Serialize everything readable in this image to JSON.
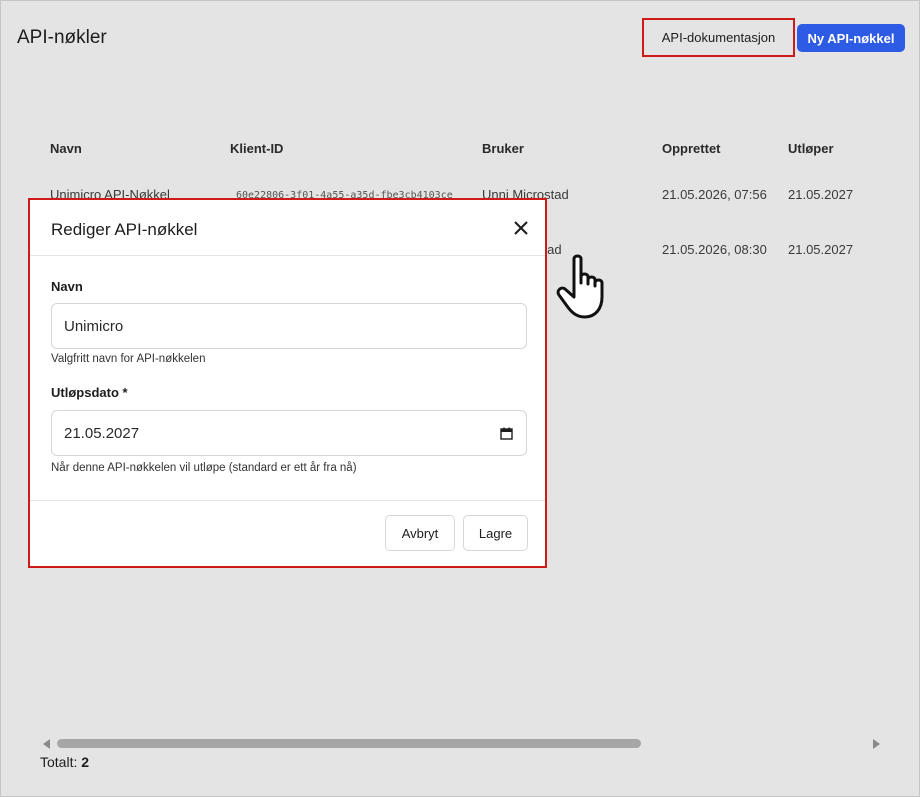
{
  "page": {
    "title": "API-nøkler",
    "docs_button": "API-dokumentasjon",
    "new_button": "Ny API-nøkkel"
  },
  "table": {
    "columns": [
      "Navn",
      "Klient-ID",
      "Bruker",
      "Opprettet",
      "Utløper"
    ],
    "rows": [
      {
        "name": "Unimicro API-Nøkkel",
        "client_id": "60e22806-3f01-4a55-a35d-fbe3cb4103ce",
        "user": "Unni Microstad",
        "created": "21.05.2026, 07:56",
        "expires": "21.05.2027"
      },
      {
        "name": "",
        "client_id": "",
        "user": "stad",
        "created": "21.05.2026, 08:30",
        "expires": "21.05.2027"
      }
    ]
  },
  "modal": {
    "title": "Rediger API-nøkkel",
    "name_label": "Navn",
    "name_value": "Unimicro",
    "name_help": "Valgfritt navn for API-nøkkelen",
    "expiry_label": "Utløpsdato *",
    "expiry_value": "21.05.2027",
    "expiry_help": "Når denne API-nøkkelen vil utløpe (standard er ett år fra nå)",
    "cancel_button": "Avbryt",
    "save_button": "Lagre"
  },
  "footer": {
    "total_label": "Totalt:",
    "total_value": "2"
  },
  "icons": {
    "close": "close-icon",
    "calendar": "calendar-icon",
    "cursor": "hand-pointer-icon"
  },
  "colors": {
    "primary": "#2e5be3",
    "highlight": "#d01a1a",
    "backdrop": "#e4e4e4"
  }
}
